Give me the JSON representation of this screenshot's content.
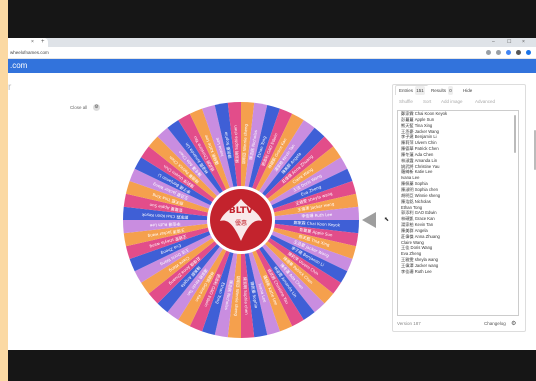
{
  "browser": {
    "tab_close": "×",
    "tab_new": "+",
    "url": "wheelofnames.com",
    "win_min": "–",
    "win_max": "☐",
    "win_close": "×"
  },
  "site": {
    "name": ".com",
    "subtitle": "r"
  },
  "toolbar": {
    "close_all": "Close all",
    "close_icon": "gear-icon"
  },
  "panel": {
    "tabs": [
      {
        "label": "Entries",
        "count": "151"
      },
      {
        "label": "Results",
        "count": "0"
      },
      {
        "label": "Hide"
      }
    ],
    "tools": [
      "Shuffle",
      "Sort",
      "Add image",
      "Advanced"
    ],
    "entries": [
      "鄭家霖 Chai Koon Keyok",
      "彭蔓蔓 Apple Sun",
      "熊天藍 Tina Xing",
      "王丞豪 Jacker Wang",
      "李子建 Benjamin Li",
      "陳莉萍 Uivern Chin",
      "陳德華 Patrick Chen",
      "陳冬蓮 Ada Chen",
      "林淑霞 Amanda Lin",
      "姚武將 Christine Yau",
      "羅綺新 Katie Lee",
      "Ivana Lee",
      "陳佩蓁 Sophia",
      "陳淑明 Sophia chen",
      "胡明亞 Winnie sheng",
      "陳浩銘 Nicholas",
      "Ethan Tong",
      "郭添利 GAO Edwin",
      "林碩凱 Grace Kan",
      "湯家柏 Kevin Tan",
      "陳美群 Angela",
      "莊偉傑 Anna Zhuang",
      "Claire Wang",
      "王佳 Doris Wang",
      "Eva Zheng",
      "王雅雯 sheyla wang",
      "王偉澤 Jacker wang",
      "李佳珊 Ruth Lee"
    ],
    "version": "Version 187",
    "changelog": "Changelog"
  },
  "wheel": {
    "colors": [
      "#3f5fd6",
      "#e24d8a",
      "#f5a04d",
      "#c98de0"
    ],
    "center_text_top": "BLTV",
    "center_text_bottom": "優惠"
  }
}
